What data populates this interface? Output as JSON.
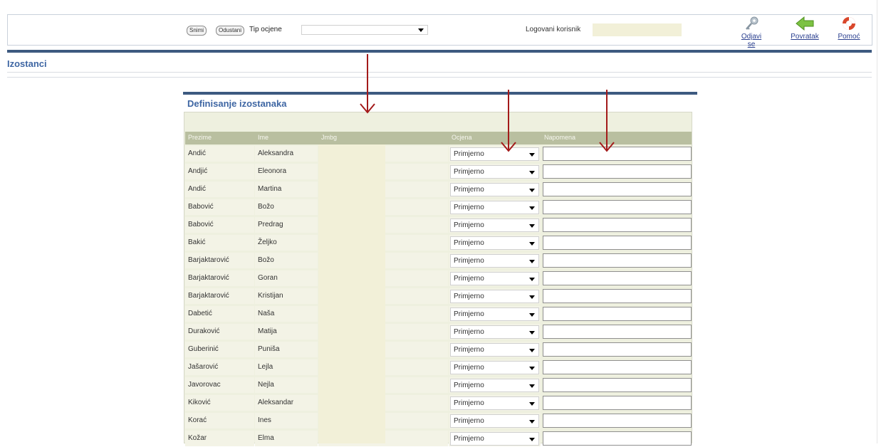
{
  "header": {
    "user_label": "Logovani korisnik",
    "user_value": "",
    "tools": [
      {
        "label": "Odjavi se",
        "icon": "key-icon"
      },
      {
        "label": "Povratak",
        "icon": "back-arrow-icon"
      },
      {
        "label": "Pomoć",
        "icon": "help-lifebuoy-icon"
      }
    ]
  },
  "section_title": "Izostanci",
  "panel": {
    "title": "Definisanje izostanaka",
    "save_label": "Snimi",
    "cancel_label": "Odustani",
    "grade_type_label": "Tip ocjene",
    "grade_type_value": ""
  },
  "table": {
    "columns": [
      "Prezime",
      "Ime",
      "Jmbg",
      "Ocjena",
      "Napomena"
    ],
    "rows": [
      {
        "prezime": "Andić",
        "ime": "Aleksandra",
        "ocjena": "Primjerno"
      },
      {
        "prezime": "Andjić",
        "ime": "Eleonora",
        "ocjena": "Primjerno"
      },
      {
        "prezime": "Andić",
        "ime": "Martina",
        "ocjena": "Primjerno"
      },
      {
        "prezime": "Babović",
        "ime": "Božo",
        "ocjena": "Primjerno"
      },
      {
        "prezime": "Babović",
        "ime": "Predrag",
        "ocjena": "Primjerno"
      },
      {
        "prezime": "Bakić",
        "ime": "Željko",
        "ocjena": "Primjerno"
      },
      {
        "prezime": "Barjaktarović",
        "ime": "Božo",
        "ocjena": "Primjerno"
      },
      {
        "prezime": "Barjaktarović",
        "ime": "Goran",
        "ocjena": "Primjerno"
      },
      {
        "prezime": "Barjaktarović",
        "ime": "Kristijan",
        "ocjena": "Primjerno"
      },
      {
        "prezime": "Dabetić",
        "ime": "Naša",
        "ocjena": "Primjerno"
      },
      {
        "prezime": "Duraković",
        "ime": "Matija",
        "ocjena": "Primjerno"
      },
      {
        "prezime": "Guberinić",
        "ime": "Puniša",
        "ocjena": "Primjerno"
      },
      {
        "prezime": "Jašarović",
        "ime": "Lejla",
        "ocjena": "Primjerno"
      },
      {
        "prezime": "Javorovac",
        "ime": "Nejla",
        "ocjena": "Primjerno"
      },
      {
        "prezime": "Kiković",
        "ime": "Aleksandar",
        "ocjena": "Primjerno"
      },
      {
        "prezime": "Korać",
        "ime": "Ines",
        "ocjena": "Primjerno"
      },
      {
        "prezime": "Kožar",
        "ime": "Elma",
        "ocjena": "Primjerno"
      }
    ]
  },
  "colors": {
    "accent": "#3d5a80",
    "title": "#3e66a3",
    "header_row": "#b9bfa0",
    "cell_bg": "#f3f3e6",
    "redacted": "#f2f0d8",
    "annotation_arrow": "#a31a1a"
  }
}
